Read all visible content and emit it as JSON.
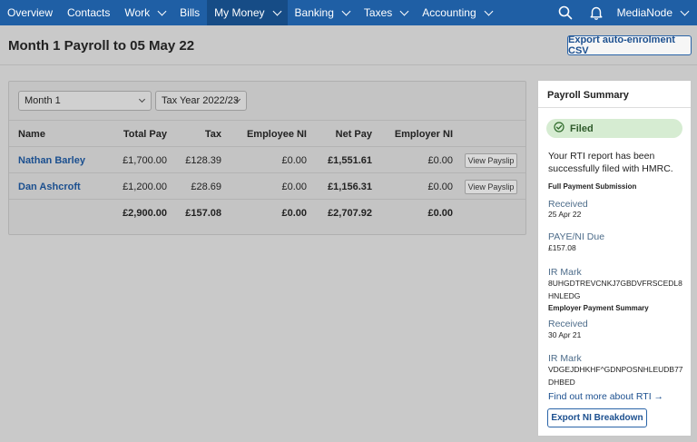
{
  "nav": {
    "items": [
      {
        "label": "Overview",
        "dropdown": false
      },
      {
        "label": "Contacts",
        "dropdown": false
      },
      {
        "label": "Work",
        "dropdown": true
      },
      {
        "label": "Bills",
        "dropdown": false
      },
      {
        "label": "My Money",
        "dropdown": true,
        "active": true
      },
      {
        "label": "Banking",
        "dropdown": true
      },
      {
        "label": "Taxes",
        "dropdown": true
      },
      {
        "label": "Accounting",
        "dropdown": true
      }
    ],
    "org_name": "MediaNode",
    "icons": [
      "search-icon",
      "bell-icon"
    ]
  },
  "page": {
    "title": "Month 1 Payroll to 05 May 22",
    "export_csv_label": "Export auto-enrolment CSV"
  },
  "filters": {
    "period": "Month 1",
    "tax_year": "Tax Year 2022/23"
  },
  "table": {
    "columns": [
      "Name",
      "Total Pay",
      "Tax",
      "Employee NI",
      "Net Pay",
      "Employer NI"
    ],
    "rows": [
      {
        "name": "Nathan Barley",
        "total_pay": "£1,700.00",
        "tax": "£128.39",
        "employee_ni": "£0.00",
        "net_pay": "£1,551.61",
        "employer_ni": "£0.00",
        "action": "View Payslip"
      },
      {
        "name": "Dan Ashcroft",
        "total_pay": "£1,200.00",
        "tax": "£28.69",
        "employee_ni": "£0.00",
        "net_pay": "£1,156.31",
        "employer_ni": "£0.00",
        "action": "View Payslip"
      }
    ],
    "totals": {
      "total_pay": "£2,900.00",
      "tax": "£157.08",
      "employee_ni": "£0.00",
      "net_pay": "£2,707.92",
      "employer_ni": "£0.00"
    }
  },
  "summary": {
    "title": "Payroll Summary",
    "status": "Filed",
    "status_color": "#d6ecd2",
    "message": "Your RTI report has been successfully filed with HMRC.",
    "fps": {
      "heading": "Full Payment Submission",
      "received_label": "Received",
      "received_value": "25 Apr 22",
      "paye_label": "PAYE/NI Due",
      "paye_value": "£157.08",
      "irmark_label": "IR Mark",
      "irmark_value": "8UHGDTREVCNKJ7GBDVFRSCEDL8HNLEDG"
    },
    "eps": {
      "heading": "Employer Payment Summary",
      "received_label": "Received",
      "received_value": "30 Apr 21",
      "irmark_label": "IR Mark",
      "irmark_value": "VDGEJDHKHF^GDNPOSNHLEUDB77DHBED"
    },
    "link_label": "Find out more about RTI →",
    "export_ni_label": "Export NI Breakdown"
  }
}
